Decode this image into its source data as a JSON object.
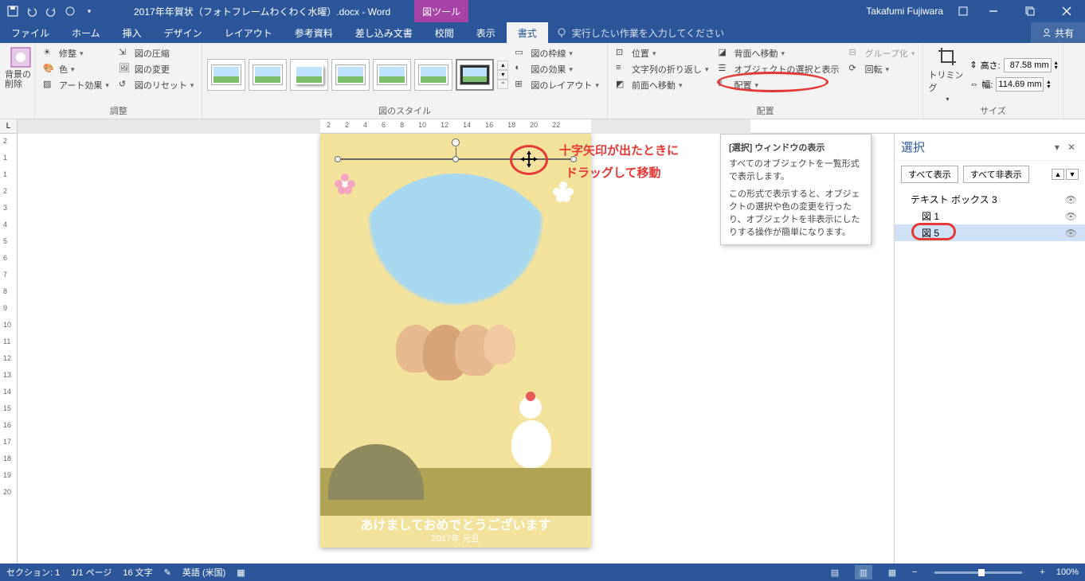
{
  "titlebar": {
    "doc_name": "2017年年賀状（フォトフレームわくわく水曜）.docx - Word",
    "context_tab": "図ツール",
    "user": "Takafumi Fujiwara"
  },
  "tabs": {
    "file": "ファイル",
    "home": "ホーム",
    "insert": "挿入",
    "design": "デザイン",
    "layout": "レイアウト",
    "references": "参考資料",
    "mailings": "差し込み文書",
    "review": "校閲",
    "view": "表示",
    "format": "書式",
    "tell_me": "実行したい作業を入力してください",
    "share": "共有"
  },
  "ribbon": {
    "remove_bg": "背景の削除",
    "corrections": "修整",
    "color": "色",
    "artistic": "アート効果",
    "compress": "図の圧縮",
    "change_pic": "図の変更",
    "reset_pic": "図のリセット",
    "group_adjust": "調整",
    "group_styles": "図のスタイル",
    "pic_border": "図の枠線",
    "pic_effects": "図の効果",
    "pic_layout": "図のレイアウト",
    "position": "位置",
    "wrap": "文字列の折り返し",
    "bring_fwd": "前面へ移動",
    "send_back": "背面へ移動",
    "sel_pane": "オブジェクトの選択と表示",
    "align": "配置",
    "group_obj": "グループ化",
    "rotate": "回転",
    "group_arrange": "配置",
    "crop": "トリミング",
    "height_lbl": "高さ:",
    "height_val": "87.58 mm",
    "width_lbl": "幅:",
    "width_val": "114.69 mm",
    "group_size": "サイズ"
  },
  "tooltip": {
    "title": "[選択] ウィンドウの表示",
    "line1": "すべてのオブジェクトを一覧形式で表示します。",
    "line2": "この形式で表示すると、オブジェクトの選択や色の変更を行ったり、オブジェクトを非表示にしたりする操作が簡単になります。"
  },
  "selpane": {
    "title": "選択",
    "show_all": "すべて表示",
    "hide_all": "すべて非表示",
    "items": [
      {
        "label": "テキスト ボックス 3",
        "sub": false,
        "sel": false
      },
      {
        "label": "図 1",
        "sub": true,
        "sel": false
      },
      {
        "label": "図 5",
        "sub": true,
        "sel": true
      }
    ]
  },
  "annotations": {
    "line1": "十字矢印が出たときに",
    "line2": "ドラッグして移動"
  },
  "page": {
    "greeting": "あけましておめでとうございます",
    "year": "2017年 元旦"
  },
  "ruler": {
    "marks": [
      "2",
      "2",
      "4",
      "6",
      "8",
      "10",
      "12",
      "14",
      "16",
      "18",
      "20",
      "22"
    ]
  },
  "ruler_v": {
    "marks": [
      "2",
      "1",
      "1",
      "2",
      "3",
      "4",
      "5",
      "6",
      "7",
      "8",
      "9",
      "10",
      "11",
      "12",
      "13",
      "14",
      "15",
      "16",
      "17",
      "18",
      "19",
      "20"
    ]
  },
  "status": {
    "section": "セクション: 1",
    "page": "1/1 ページ",
    "words": "16 文字",
    "lang": "英語 (米国)",
    "zoom": "100%"
  }
}
